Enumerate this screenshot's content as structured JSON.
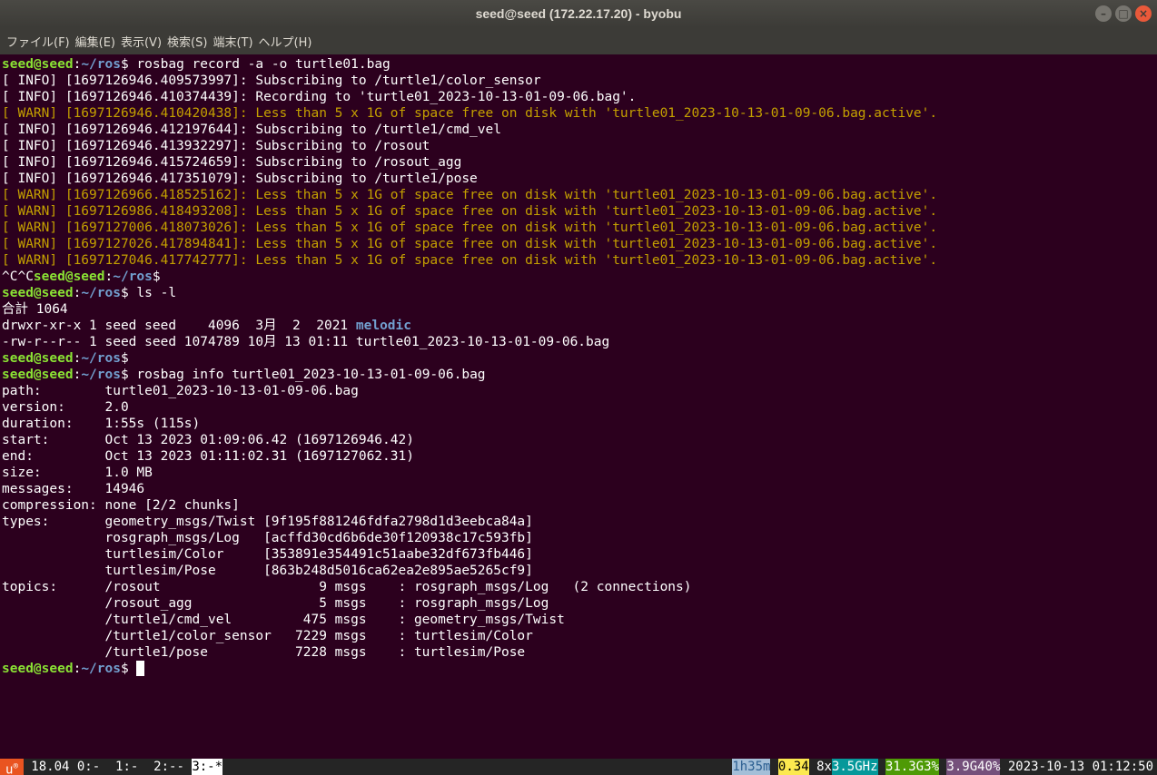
{
  "window": {
    "title": "seed@seed (172.22.17.20) - byobu",
    "controls": [
      "–",
      "□",
      "×"
    ]
  },
  "menu": [
    "ファイル(F)",
    "編集(E)",
    "表示(V)",
    "検索(S)",
    "端末(T)",
    "ヘルプ(H)"
  ],
  "prompt": {
    "user": "seed@seed",
    "sep": ":",
    "path": "~/ros",
    "symbol": "$"
  },
  "terminal": {
    "cmd1": " rosbag record -a -o turtle01.bag",
    "log": [
      {
        "level": "info",
        "text": "[ INFO] [1697126946.409573997]: Subscribing to /turtle1/color_sensor"
      },
      {
        "level": "info",
        "text": "[ INFO] [1697126946.410374439]: Recording to 'turtle01_2023-10-13-01-09-06.bag'."
      },
      {
        "level": "warn",
        "text": "[ WARN] [1697126946.410420438]: Less than 5 x 1G of space free on disk with 'turtle01_2023-10-13-01-09-06.bag.active'."
      },
      {
        "level": "info",
        "text": "[ INFO] [1697126946.412197644]: Subscribing to /turtle1/cmd_vel"
      },
      {
        "level": "info",
        "text": "[ INFO] [1697126946.413932297]: Subscribing to /rosout"
      },
      {
        "level": "info",
        "text": "[ INFO] [1697126946.415724659]: Subscribing to /rosout_agg"
      },
      {
        "level": "info",
        "text": "[ INFO] [1697126946.417351079]: Subscribing to /turtle1/pose"
      },
      {
        "level": "warn",
        "text": "[ WARN] [1697126966.418525162]: Less than 5 x 1G of space free on disk with 'turtle01_2023-10-13-01-09-06.bag.active'."
      },
      {
        "level": "warn",
        "text": "[ WARN] [1697126986.418493208]: Less than 5 x 1G of space free on disk with 'turtle01_2023-10-13-01-09-06.bag.active'."
      },
      {
        "level": "warn",
        "text": "[ WARN] [1697127006.418073026]: Less than 5 x 1G of space free on disk with 'turtle01_2023-10-13-01-09-06.bag.active'."
      },
      {
        "level": "warn",
        "text": "[ WARN] [1697127026.417894841]: Less than 5 x 1G of space free on disk with 'turtle01_2023-10-13-01-09-06.bag.active'."
      },
      {
        "level": "warn",
        "text": "[ WARN] [1697127046.417742777]: Less than 5 x 1G of space free on disk with 'turtle01_2023-10-13-01-09-06.bag.active'."
      }
    ],
    "interrupt": "^C^C",
    "cmd2": " ls -l",
    "total": "合計 1064",
    "ls_dir_prefix": "drwxr-xr-x 1 seed seed    4096  3月  2  2021 ",
    "ls_dir_name": "melodic",
    "ls_file": "-rw-r--r-- 1 seed seed 1074789 10月 13 01:11 turtle01_2023-10-13-01-09-06.bag",
    "cmd3": " rosbag info turtle01_2023-10-13-01-09-06.bag",
    "info": [
      "path:        turtle01_2023-10-13-01-09-06.bag",
      "version:     2.0",
      "duration:    1:55s (115s)",
      "start:       Oct 13 2023 01:09:06.42 (1697126946.42)",
      "end:         Oct 13 2023 01:11:02.31 (1697127062.31)",
      "size:        1.0 MB",
      "messages:    14946",
      "compression: none [2/2 chunks]",
      "types:       geometry_msgs/Twist [9f195f881246fdfa2798d1d3eebca84a]",
      "             rosgraph_msgs/Log   [acffd30cd6b6de30f120938c17c593fb]",
      "             turtlesim/Color     [353891e354491c51aabe32df673fb446]",
      "             turtlesim/Pose      [863b248d5016ca62ea2e895ae5265cf9]",
      "topics:      /rosout                    9 msgs    : rosgraph_msgs/Log   (2 connections)",
      "             /rosout_agg                5 msgs    : rosgraph_msgs/Log",
      "             /turtle1/cmd_vel         475 msgs    : geometry_msgs/Twist",
      "             /turtle1/color_sensor   7229 msgs    : turtlesim/Color",
      "             /turtle1/pose           7228 msgs    : turtlesim/Pose"
    ]
  },
  "status": {
    "logo": "u",
    "logo_mark": "®",
    "release": " 18.04 ",
    "windows": [
      "0:- ",
      " 1:- ",
      " 2:-- "
    ],
    "active_window": "3:-*",
    "uptime": "1h35m",
    "load": "0.34",
    "cpu_count": " 8x",
    "cpu_freq": "3.5GHz",
    "mem": "31.3G3%",
    "disk": "3.9G40%",
    "datetime": " 2023-10-13 01:12:50"
  },
  "colors": {
    "terminal_bg": "#2c001e",
    "prompt_user": "#8ae234",
    "prompt_path": "#729fcf",
    "warn": "#c4a000",
    "ubuntu_orange": "#e95420"
  }
}
